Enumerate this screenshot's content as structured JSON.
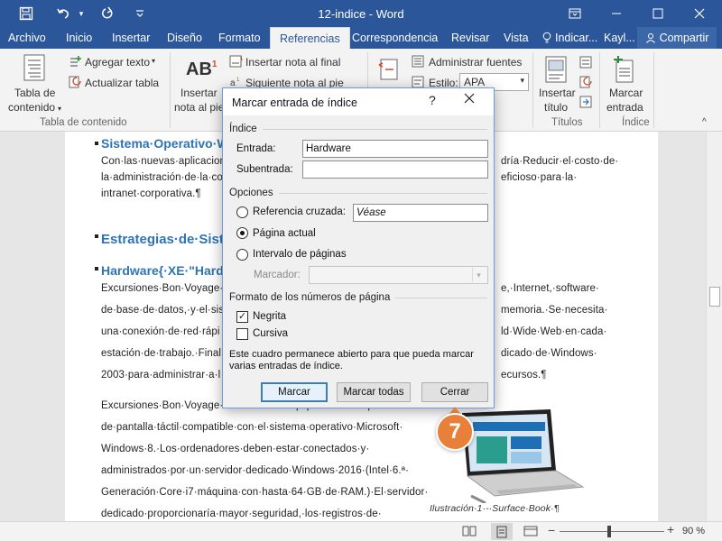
{
  "titlebar": {
    "doc_title": "12-indice - Word"
  },
  "tabs": {
    "items": [
      {
        "label": "Archivo"
      },
      {
        "label": "Inicio"
      },
      {
        "label": "Insertar"
      },
      {
        "label": "Diseño"
      },
      {
        "label": "Formato"
      },
      {
        "label": "Referencias"
      },
      {
        "label": "Correspondencia"
      },
      {
        "label": "Revisar"
      },
      {
        "label": "Vista"
      }
    ],
    "active": "Referencias",
    "tell_me": "Indicar...",
    "user": "Kayl...",
    "share": "Compartir"
  },
  "ribbon": {
    "toc_label_line1": "Tabla de",
    "toc_label_line2": "contenido",
    "add_text": "Agregar texto",
    "update_table": "Actualizar tabla",
    "toc_group": "Tabla de contenido",
    "insert_footnote_line1": "Insertar",
    "insert_footnote_line2": "nota al pie",
    "insert_endnote": "Insertar nota al final",
    "next_footnote": "Siguiente nota al pie",
    "manage_sources": "Administrar fuentes",
    "style_label": "Estilo:",
    "style_value": "APA",
    "insert_caption_line1": "Insertar",
    "insert_caption_line2": "título",
    "captions_group": "Títulos",
    "mark_entry_line1": "Marcar",
    "mark_entry_line2": "entrada",
    "index_group": "Índice",
    "footnote_superscript": "AB",
    "footnote_number": "1"
  },
  "document": {
    "lines": [
      {
        "type": "heading",
        "text": "Sistema·Operativo·Wi"
      },
      {
        "type": "text",
        "text": "Con·las·nuevas·aplicacion"
      },
      {
        "type": "text",
        "text": "la·administración·de·la·co"
      },
      {
        "type": "text",
        "text": "intranet·corporativa.¶"
      },
      {
        "type": "heading-big",
        "text": "Estrategias·de·Sister"
      },
      {
        "type": "heading",
        "text": "Hardware{·XE·\"Hardw"
      },
      {
        "type": "text",
        "text": "Excursiones·Bon·Voyage·"
      },
      {
        "type": "text",
        "text": "de·base·de·datos,·y·el·sist"
      },
      {
        "type": "text",
        "text": "una·conexión·de·red·rápi"
      },
      {
        "type": "text",
        "text": "estación·de·trabajo.·Final"
      },
      {
        "type": "text",
        "text": "2003·para·administrar·a·l"
      },
      {
        "type": "text",
        "text": "Excursiones·Bon·Voyage·deberá·estar·equipado·con·dispositivos·"
      },
      {
        "type": "text",
        "text": "de·pantalla·táctil·compatible·con·el·sistema·operativo·Microsoft·"
      },
      {
        "type": "text",
        "text": "Windows·8.·Los·ordenadores·deben·estar·conectados·y·"
      },
      {
        "type": "text",
        "text": "administrados·por·un·servidor·dedicado·Windows·2016·(Intel·6.ª·"
      },
      {
        "type": "text",
        "text": "Generación·Core·i7·máquina·con·hasta·64·GB·de·RAM.)·El·servidor·"
      },
      {
        "type": "text",
        "text": "dedicado·proporcionaría·mayor·seguridad,·los·registros·de·"
      }
    ],
    "right_fragments": [
      "dría·Reducir·el·costo·de·",
      "eficioso·para·la·",
      "e,·Internet,·software·",
      "memoria.·Se·necesita·",
      "ld·Wide·Web·en·cada·",
      "dicado·de·Windows·",
      "ecursos.¶"
    ],
    "caption": "Ilustración·1·-·Surface·Book·¶"
  },
  "status": {
    "zoom": "90 %",
    "zoom_minus": "−",
    "zoom_plus": "+"
  },
  "dialog": {
    "title": "Marcar entrada de índice",
    "help": "?",
    "section_index": "Índice",
    "entry_label": "Entrada:",
    "entry_value": "Hardware",
    "subentry_label": "Subentrada:",
    "subentry_value": "",
    "section_options": "Opciones",
    "cross_ref_label": "Referencia cruzada:",
    "cross_ref_value": "Véase",
    "current_page_label": "Página actual",
    "page_range_label": "Intervalo de páginas",
    "bookmark_label": "Marcador:",
    "section_format": "Formato de los números de página",
    "bold_label": "Negrita",
    "italic_label": "Cursiva",
    "note": "Este cuadro permanece abierto para que pueda marcar varias entradas de índice.",
    "mark_button": "Marcar",
    "mark_all_button": "Marcar todas",
    "close_button": "Cerrar",
    "bold_checked": true,
    "italic_checked": false,
    "selected_option": "Página actual"
  },
  "callout": {
    "step": "7"
  },
  "colors": {
    "word_blue": "#2b579a",
    "heading_blue": "#2e74b5",
    "callout_orange": "#e8803a"
  }
}
